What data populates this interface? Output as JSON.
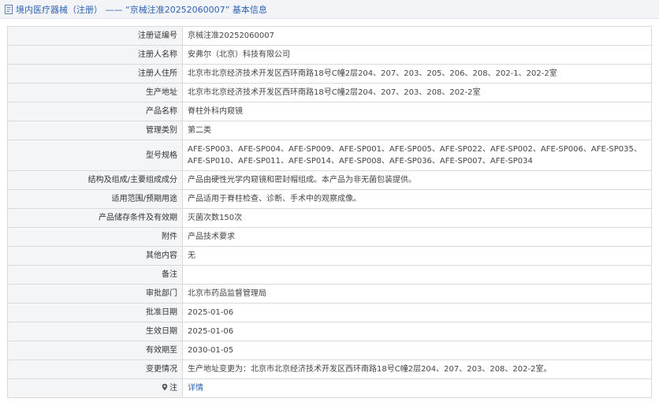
{
  "header": {
    "title": "境内医疗器械（注册） —— “京械注准20252060007” 基本信息",
    "icon": "document-icon"
  },
  "rows": [
    {
      "key": "reg_no",
      "label": "注册证编号",
      "value": "京械注准20252060007"
    },
    {
      "key": "registrant",
      "label": "注册人名称",
      "value": "安弗尔（北京）科技有限公司"
    },
    {
      "key": "registrant_address",
      "label": "注册人住所",
      "value": "北京市北京经济技术开发区西环南路18号C幢2层204、207、203、205、206、208、202-1、202-2室"
    },
    {
      "key": "production_address",
      "label": "生产地址",
      "value": "北京市北京经济技术开发区西环南路18号C幢2层204、207、203、208、202-2室"
    },
    {
      "key": "product_name",
      "label": "产品名称",
      "value": "脊柱外科内窥镜"
    },
    {
      "key": "category",
      "label": "管理类别",
      "value": "第二类"
    },
    {
      "key": "models",
      "label": "型号规格",
      "value": "AFE-SP003、AFE-SP004、AFE-SP009、AFE-SP001、AFE-SP005、AFE-SP022、AFE-SP002、AFE-SP006、AFE-SP035、AFE-SP010、AFE-SP011、AFE-SP014、AFE-SP008、AFE-SP036、AFE-SP007、AFE-SP034",
      "tall": true
    },
    {
      "key": "structure",
      "label": "结构及组成/主要组成成分",
      "value": "产品由硬性光学内窥镜和密封帽组成。本产品为非无菌包装提供。"
    },
    {
      "key": "intended_use",
      "label": "适用范围/预期用途",
      "value": "产品适用于脊柱检查、诊断、手术中的观察成像。"
    },
    {
      "key": "storage",
      "label": "产品储存条件及有效期",
      "value": "灭菌次数150次"
    },
    {
      "key": "attachment",
      "label": "附件",
      "value": "产品技术要求"
    },
    {
      "key": "other",
      "label": "其他内容",
      "value": "无"
    },
    {
      "key": "remarks",
      "label": "备注",
      "value": ""
    },
    {
      "key": "approval_dept",
      "label": "审批部门",
      "value": "北京市药品监督管理局"
    },
    {
      "key": "approval_date",
      "label": "批准日期",
      "value": "2025-01-06"
    },
    {
      "key": "effective_date",
      "label": "生效日期",
      "value": "2025-01-06"
    },
    {
      "key": "expiry_date",
      "label": "有效期至",
      "value": "2030-01-05"
    },
    {
      "key": "changes",
      "label": "变更情况",
      "value": "生产地址变更为：北京市北京经济技术开发区西环南路18号C幢2层204、207、203、208、202-2室。"
    },
    {
      "key": "note",
      "label": "注",
      "value": "详情",
      "link": true,
      "icon": "location-pin-icon"
    }
  ]
}
